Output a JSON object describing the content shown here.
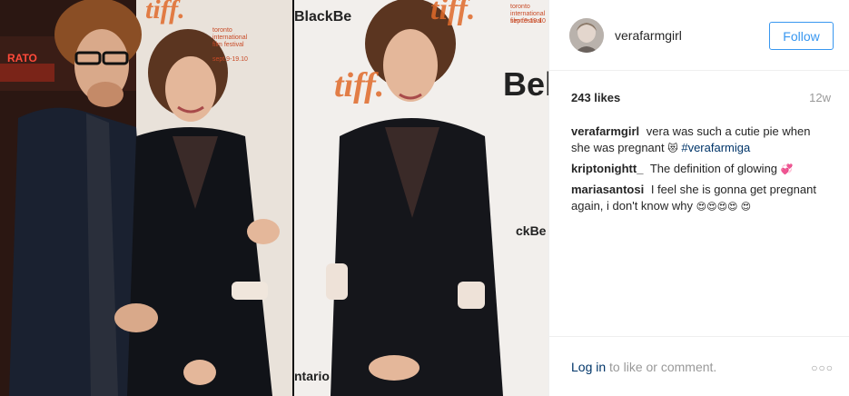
{
  "photo": {
    "left_panel": {
      "tiff_text": "tiff.",
      "festival_text": "toronto international film festival",
      "dates_text": "sept.9-19.10",
      "sign_text": "RATO"
    },
    "right_panel": {
      "tiff_text": "tiff.",
      "festival_text": "toronto international film festival",
      "dates_text": "sept.9-19.10",
      "sponsor_blackberry": "BlackBe",
      "sponsor_bell": "Bel",
      "sponsor_bell_small": "ckBe",
      "sponsor_ontario": "ntario"
    }
  },
  "header": {
    "username": "verafarmgirl",
    "follow_label": "Follow"
  },
  "stats": {
    "likes": "243 likes",
    "time": "12w"
  },
  "comments": [
    {
      "user": "verafarmgirl",
      "text": "vera was such a cutie pie when she was pregnant",
      "emoji": "😻",
      "hashtag": "#verafarmiga"
    },
    {
      "user": "kriptonightt_",
      "text": "The definition of glowing",
      "emoji": "💞"
    },
    {
      "user": "mariasantosi",
      "text": "I feel she is gonna get pregnant again, i don't know why",
      "emoji": "😍😍😍😍 😍"
    }
  ],
  "footer": {
    "login_link": "Log in",
    "login_text": "to like or comment.",
    "more": "○○○"
  },
  "colors": {
    "link": "#003569",
    "follow": "#3897f0",
    "muted": "#999999",
    "tiff_orange": "#e06a2a"
  },
  "icons": [
    "more-options-icon"
  ]
}
